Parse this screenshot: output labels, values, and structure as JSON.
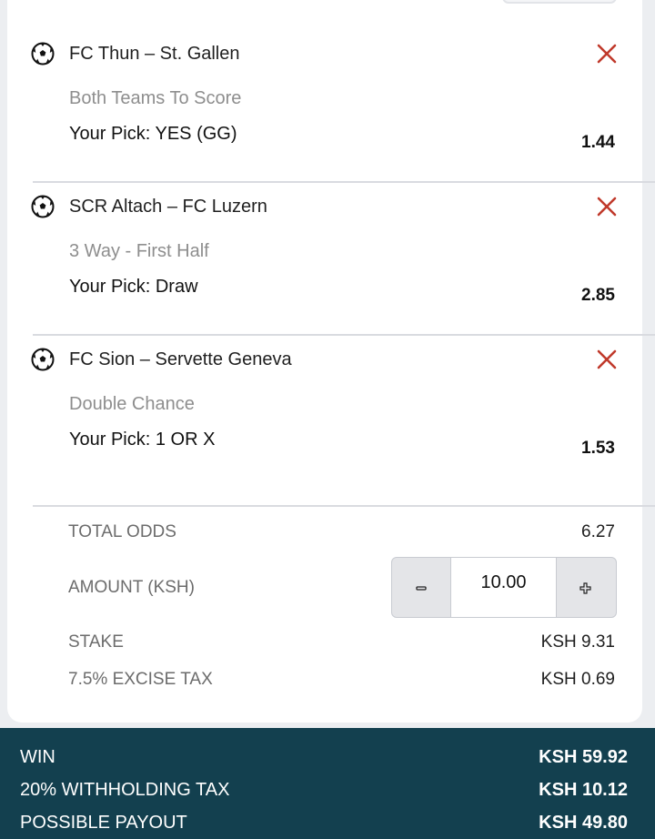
{
  "bets": [
    {
      "match": "FC Thun – St. Gallen",
      "market": "Both Teams To Score",
      "pick": "Your Pick: YES (GG)",
      "odds": "1.44"
    },
    {
      "match": "SCR Altach – FC Luzern",
      "market": "3 Way - First Half",
      "pick": "Your Pick: Draw",
      "odds": "2.85"
    },
    {
      "match": "FC Sion – Servette Geneva",
      "market": "Double Chance",
      "pick": "Your Pick: 1 OR X",
      "odds": "1.53"
    }
  ],
  "summary": {
    "total_odds_label": "TOTAL ODDS",
    "total_odds_value": "6.27",
    "amount_label": "AMOUNT (KSH)",
    "amount_value": "10.00",
    "stake_label": "STAKE",
    "stake_value": "KSH 9.31",
    "excise_label": "7.5% EXCISE TAX",
    "excise_value": "KSH 0.69"
  },
  "footer": {
    "win_label": "WIN",
    "win_value": "KSH 59.92",
    "wht_label": "20% WITHHOLDING TAX",
    "wht_value": "KSH 10.12",
    "payout_label": "POSSIBLE PAYOUT",
    "payout_value": "KSH 49.80"
  },
  "icons": {
    "sport": "soccer-ball-icon",
    "remove": "close-icon",
    "decrement": "minus-icon",
    "increment": "plus-icon"
  },
  "colors": {
    "remove": "#c0392b",
    "footer_bg": "#13404f",
    "muted": "#8e8e8e"
  }
}
